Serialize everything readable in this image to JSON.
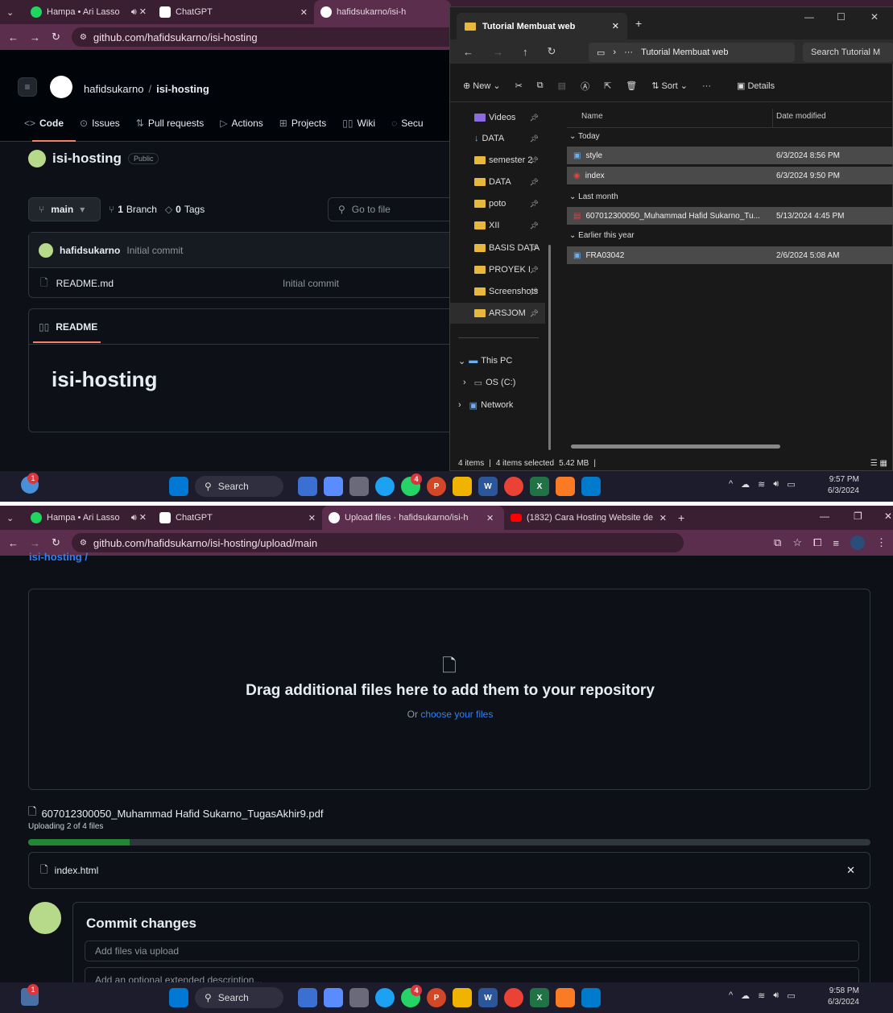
{
  "top": {
    "tabs": [
      {
        "label": "Hampa • Ari Lasso"
      },
      {
        "label": "ChatGPT"
      },
      {
        "label": "hafidsukarno/isi-h"
      }
    ],
    "url": "github.com/hafidsukarno/isi-hosting",
    "breadcrumb_owner": "hafidsukarno",
    "breadcrumb_sep": "/",
    "breadcrumb_repo": "isi-hosting",
    "nav": [
      "Code",
      "Issues",
      "Pull requests",
      "Actions",
      "Projects",
      "Wiki",
      "Secu"
    ],
    "repo_name": "isi-hosting",
    "visibility": "Public",
    "branch": "main",
    "branch_count": "1",
    "branch_label": "Branch",
    "tag_count": "0",
    "tag_label": "Tags",
    "goto_file": "Go to file",
    "commit_author": "hafidsukarno",
    "commit_msg": "Initial commit",
    "file_name": "README.md",
    "file_commit": "Initial commit",
    "readme_tab": "README",
    "readme_heading": "isi-hosting",
    "explorer": {
      "tab_title": "Tutorial Membuat web",
      "path_more": "···",
      "path_folder": "Tutorial Membuat web",
      "search_placeholder": "Search Tutorial M",
      "toolbar": {
        "new": "New",
        "sort": "Sort",
        "more": "···",
        "details": "Details"
      },
      "sidebar": [
        "Videos",
        "DATA",
        "semester 2",
        "DATA",
        "poto",
        "XII",
        "BASIS DATA",
        "PROYEK I",
        "Screenshots",
        "ARSJOM"
      ],
      "tree": [
        "This PC",
        "OS (C:)",
        "Network"
      ],
      "col_name": "Name",
      "col_date": "Date modified",
      "groups": [
        "Today",
        "Last month",
        "Earlier this year"
      ],
      "files": [
        {
          "name": "style",
          "date": "6/3/2024 8:56 PM"
        },
        {
          "name": "index",
          "date": "6/3/2024 9:50 PM"
        },
        {
          "name": "607012300050_Muhammad Hafid Sukarno_Tu...",
          "date": "5/13/2024 4:45 PM"
        },
        {
          "name": "FRA03042",
          "date": "2/6/2024 5:08 AM"
        }
      ],
      "status_items": "4 items",
      "status_sep": "|",
      "status_selected": "4 items selected",
      "status_size": "5.42 MB"
    },
    "window_controls": {
      "min": "—",
      "max": "☐",
      "close": "✕"
    },
    "taskbar": {
      "search": "Search",
      "notif": "1",
      "wa_badge": "4",
      "time": "9:57 PM",
      "date": "6/3/2024"
    }
  },
  "bottom": {
    "tabs": [
      {
        "label": "Hampa • Ari Lasso"
      },
      {
        "label": "ChatGPT"
      },
      {
        "label": "Upload files · hafidsukarno/isi-h"
      },
      {
        "label": "(1832) Cara Hosting Website de"
      }
    ],
    "url": "github.com/hafidsukarno/isi-hosting/upload/main",
    "breadcrumb_partial": "isi-hosting /",
    "drop_title": "Drag additional files here to add them to your repository",
    "drop_or": "Or",
    "drop_link": "choose your files",
    "uploading_file": "607012300050_Muhammad Hafid Sukarno_TugasAkhir9.pdf",
    "uploading_status": "Uploading 2 of 4 files",
    "progress": 0.12,
    "queued_file": "index.html",
    "commit_title": "Commit changes",
    "commit_placeholder": "Add files via upload",
    "desc_placeholder": "Add an optional extended description...",
    "taskbar": {
      "search": "Search",
      "notif": "1",
      "wa_badge": "4",
      "time": "9:58 PM",
      "date": "6/3/2024"
    }
  },
  "colors": {
    "accent": "#2f81f7",
    "progress": "#238636",
    "tab_bar": "#3a1e32",
    "address_bar": "#5a2e4c",
    "gh_bg": "#0d1117"
  }
}
